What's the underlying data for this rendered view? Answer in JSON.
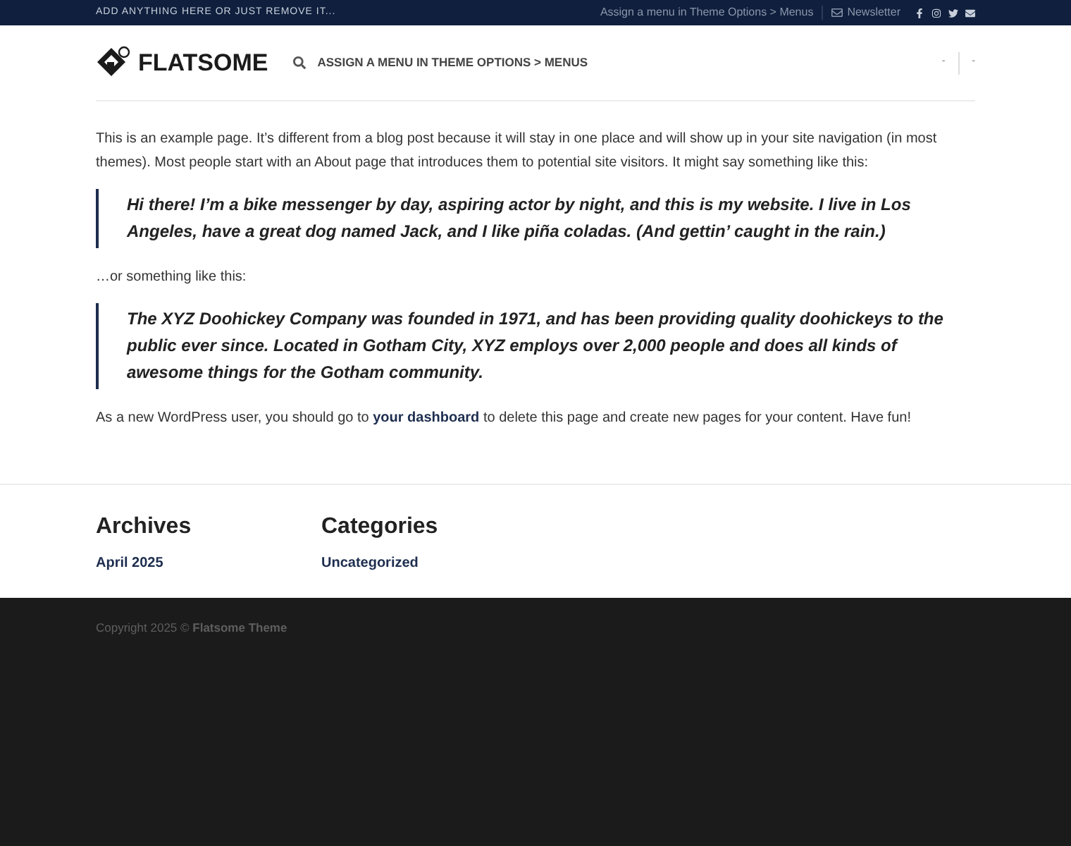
{
  "top_bar": {
    "message": "ADD ANYTHING HERE OR JUST REMOVE IT...",
    "menu_hint": "Assign a menu in Theme Options > Menus",
    "newsletter": "Newsletter"
  },
  "header": {
    "logo": "FLATSOME",
    "nav_hint": "ASSIGN A MENU IN THEME OPTIONS > MENUS",
    "right_items": [
      "-",
      "-"
    ]
  },
  "content": {
    "intro": "This is an example page. It’s different from a blog post because it will stay in one place and will show up in your site navigation (in most themes). Most people start with an About page that introduces them to potential site visitors. It might say something like this:",
    "quote_1": "Hi there! I’m a bike messenger by day, aspiring actor by night, and this is my website. I live in Los Angeles, have a great dog named Jack, and I like piña coladas. (And gettin’ caught in the rain.)",
    "between": "…or something like this:",
    "quote_2": "The XYZ Doohickey Company was founded in 1971, and has been providing quality doohickeys to the public ever since. Located in Gotham City, XYZ employs over 2,000 people and does all kinds of awesome things for the Gotham community.",
    "outro_before": "As a new WordPress user, you should go to",
    "outro_link": "your dashboard",
    "outro_after": "to delete this page and create new pages for your content. Have fun!"
  },
  "widgets": [
    {
      "title": "Archives",
      "link": "April 2025"
    },
    {
      "title": "Categories",
      "link": "Uncategorized"
    }
  ],
  "footer": {
    "copyright": "Copyright 2025 © **Flatsome Theme**"
  }
}
